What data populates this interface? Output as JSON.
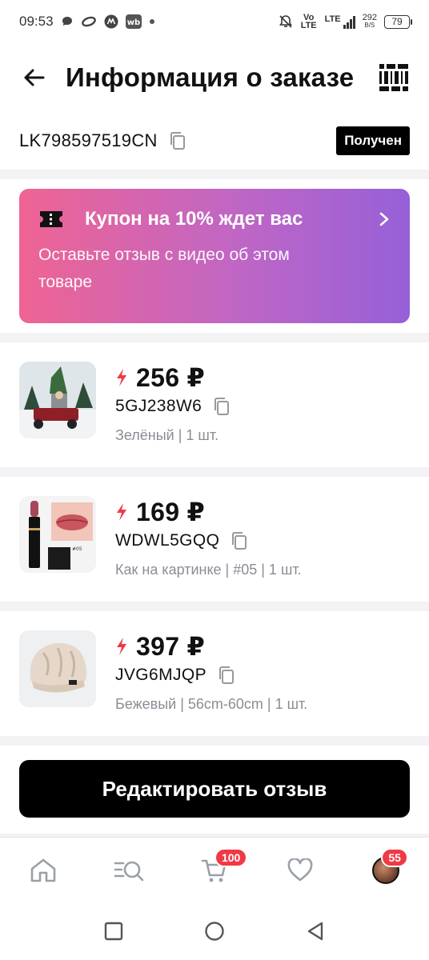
{
  "status_bar": {
    "time": "09:53",
    "left_icons": [
      "chat-bubble-icon",
      "oval-app-icon",
      "m-app-icon",
      "wb-app-icon",
      "dot-icon"
    ],
    "right_icons": [
      "mute-bell-icon",
      "volte-icon",
      "lte-signal-icon"
    ],
    "volte": "Vo LTE",
    "lte": "LTE",
    "net_speed_value": "292",
    "net_speed_unit": "B/S",
    "battery": "79"
  },
  "header": {
    "title": "Информация о заказе",
    "back_icon": "arrow-left-icon",
    "barcode_icon": "barcode-icon"
  },
  "order": {
    "id": "LK798597519CN",
    "status": "Получен"
  },
  "coupon": {
    "title": "Купон на 10% ждет вас",
    "subtitle": "Оставьте отзыв с видео об этом товаре",
    "icon": "ticket-icon"
  },
  "products": [
    {
      "price": "256 ₽",
      "sku": "5GJ238W6",
      "variant": "Зелёный | 1 шт."
    },
    {
      "price": "169 ₽",
      "sku": "WDWL5GQQ",
      "variant": "Как на картинке | #05 | 1 шт."
    },
    {
      "price": "397 ₽",
      "sku": "JVG6MJQP",
      "variant": "Бежевый | 56cm-60cm | 1 шт."
    }
  ],
  "edit_review_button": "Редактировать отзыв",
  "tabbar": {
    "cart_badge": "100",
    "profile_badge": "55",
    "tabs": [
      "home-icon",
      "catalog-search-icon",
      "cart-icon",
      "favorites-heart-icon",
      "profile-avatar"
    ]
  },
  "accent_colors": {
    "coupon_start": "#ef6493",
    "coupon_end": "#9660d8",
    "bolt": "#ef3a45",
    "badge": "#ef3a45"
  }
}
